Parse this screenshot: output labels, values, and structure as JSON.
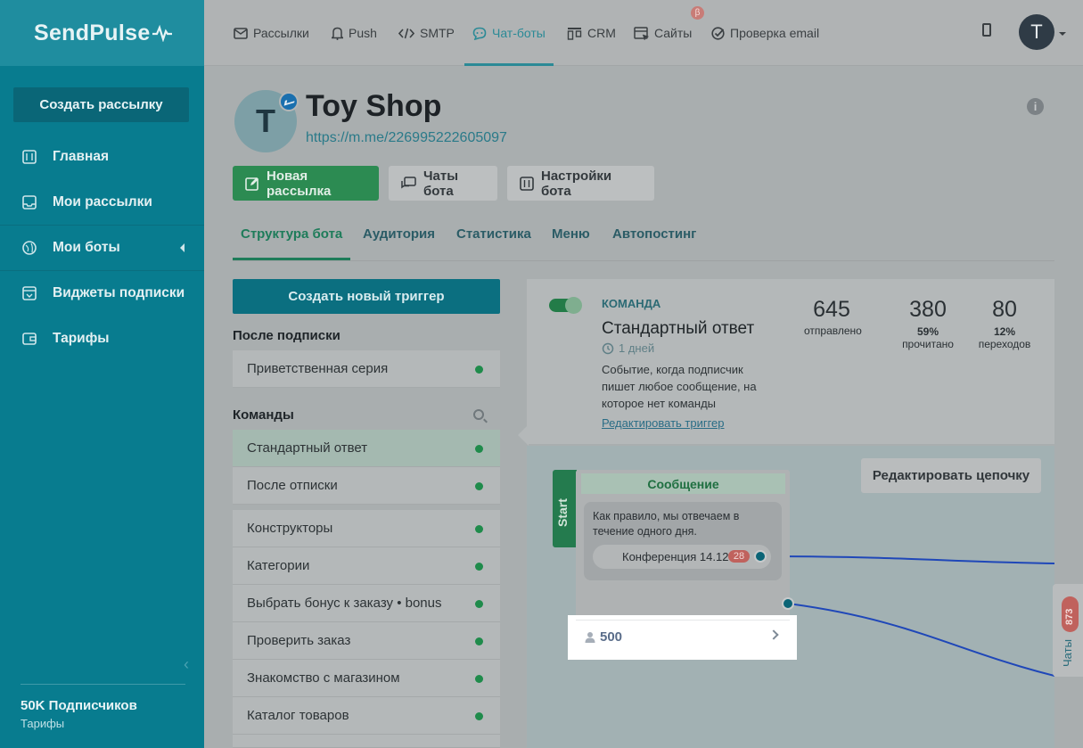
{
  "brand": {
    "name": "SendPulse"
  },
  "sidebar": {
    "create_label": "Создать рассылку",
    "items": [
      {
        "label": "Главная",
        "icon": "sliders-icon"
      },
      {
        "label": "Мои рассылки",
        "icon": "inbox-icon"
      },
      {
        "label": "Мои боты",
        "icon": "globe-icon"
      },
      {
        "label": "Виджеты подписки",
        "icon": "widget-icon"
      },
      {
        "label": "Тарифы",
        "icon": "wallet-icon"
      }
    ],
    "subscribers": "50K Подписчиков",
    "tariffs": "Тарифы"
  },
  "topnav": {
    "items": [
      {
        "label": "Рассылки",
        "icon": "mail-icon"
      },
      {
        "label": "Push",
        "icon": "bell-icon"
      },
      {
        "label": "SMTP",
        "icon": "code-icon"
      },
      {
        "label": "Чат-боты",
        "icon": "chatbot-icon"
      },
      {
        "label": "CRM",
        "icon": "crm-icon"
      },
      {
        "label": "Сайты",
        "icon": "site-icon"
      },
      {
        "label": "Проверка email",
        "icon": "check-icon"
      }
    ],
    "beta": "β",
    "avatar_letter": "T"
  },
  "bot": {
    "avatar_letter": "T",
    "name": "Toy Shop",
    "link": "https://m.me/226995222605097",
    "info": "i"
  },
  "actions": {
    "new_mailing": "Новая рассылка",
    "bot_chats": "Чаты бота",
    "bot_settings": "Настройки бота"
  },
  "tabs": [
    "Структура бота",
    "Аудитория",
    "Статистика",
    "Меню",
    "Автопостинг"
  ],
  "triggers": {
    "new_trigger": "Создать новый триггер",
    "after_subscribe_title": "После подписки",
    "after_subscribe": [
      "Приветственная серия"
    ],
    "commands_title": "Команды",
    "commands": [
      "Стандартный ответ",
      "После отписки",
      "Конструкторы",
      "Категории",
      "Выбрать бонус к заказу • bonus",
      "Проверить заказ",
      "Знакомство с магазином",
      "Каталог товаров"
    ]
  },
  "command": {
    "label": "КОМАНДА",
    "name": "Стандартный ответ",
    "days": "1 дней",
    "description": "Событие, когда подписчик пишет любое сообщение, на которое нет команды",
    "edit": "Редактировать триггер",
    "stats": [
      {
        "num": "645",
        "pct": "",
        "label": "отправлено"
      },
      {
        "num": "380",
        "pct": "59%",
        "label": "прочитано"
      },
      {
        "num": "80",
        "pct": "12%",
        "label": "переходов"
      }
    ]
  },
  "flow": {
    "edit_chain": "Редактировать цепочку",
    "start": "Start",
    "message_title": "Сообщение",
    "message_text": "Как правило, мы отвечаем в течение одного дня.",
    "button_label": "Конференция 14.12",
    "button_badge": "28",
    "subscribers": "500"
  },
  "chats": {
    "label": "Чаты",
    "count": "873"
  },
  "colors": {
    "sidebar": "#087c8f",
    "accent_green": "#2c8b52",
    "badge_red": "#c0625d"
  }
}
